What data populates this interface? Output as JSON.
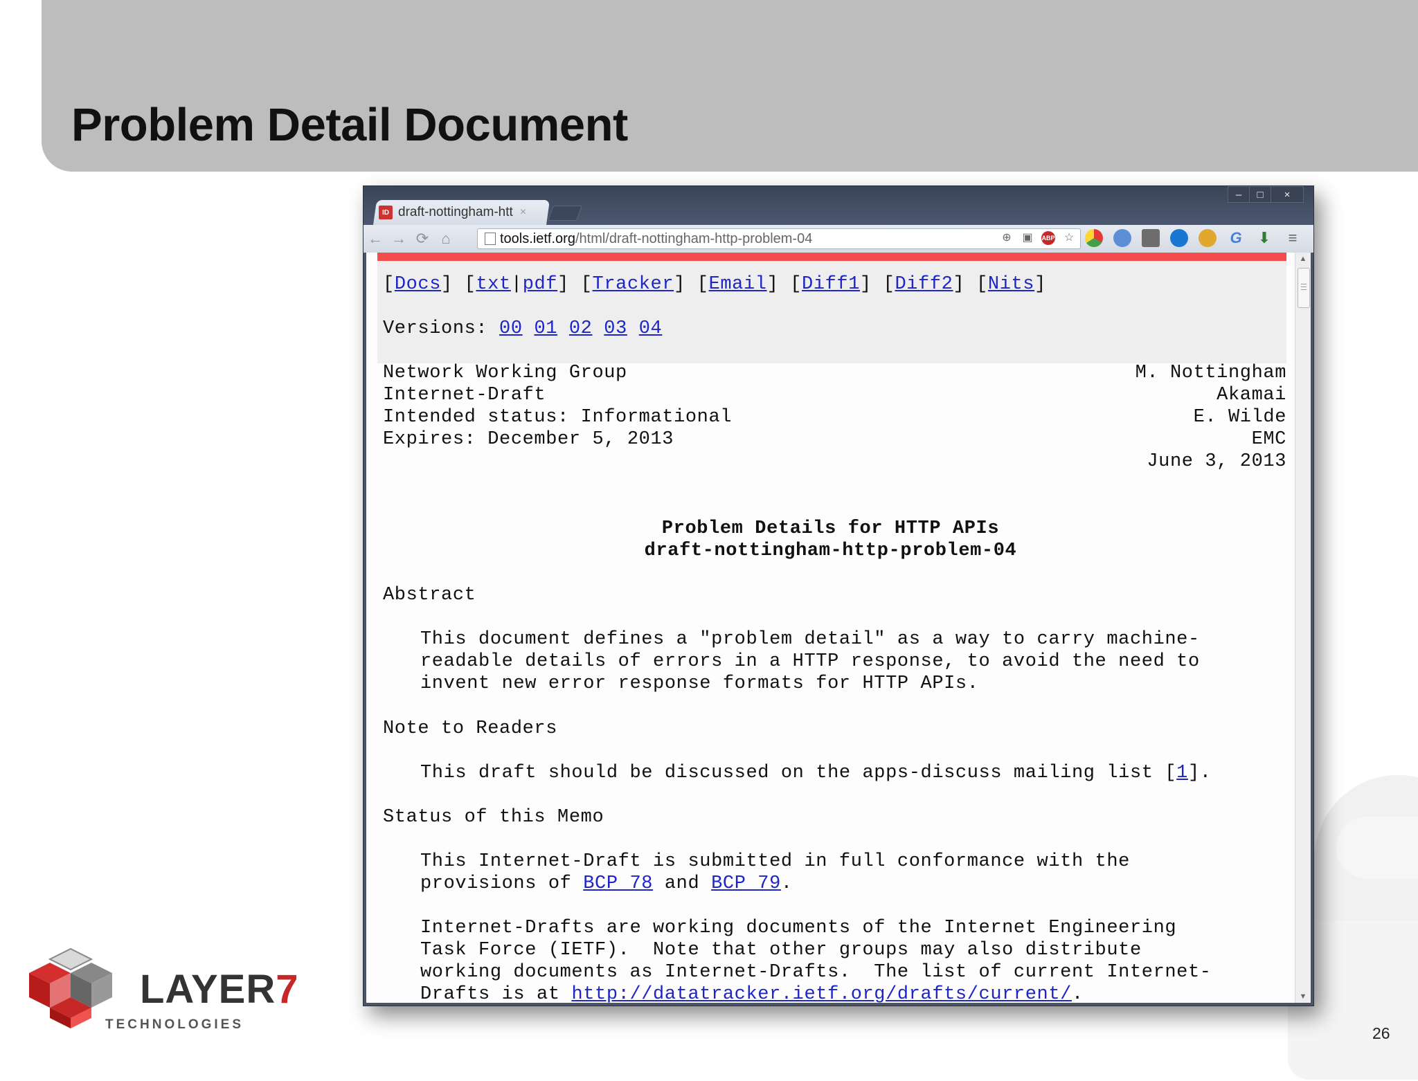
{
  "slide": {
    "title": "Problem Detail Document",
    "page_number": "26"
  },
  "logo": {
    "word": "LAYER",
    "seven": "7",
    "sub": "TECHNOLOGIES"
  },
  "browser": {
    "tab_title": "draft-nottingham-htt",
    "tab_close": "×",
    "favicon_text": "ID",
    "window_controls": {
      "minimize": "–",
      "maximize": "□",
      "close": "×"
    },
    "nav": {
      "back": "←",
      "forward": "→",
      "reload": "⟳",
      "home": "⌂"
    },
    "url_host": "tools.ietf.org",
    "url_path": "/html/draft-nottingham-http-problem-04",
    "omni_icons": {
      "zoom": "⊕",
      "page_action": "▣",
      "adblock": "ABP",
      "star": "☆"
    },
    "menu_icon": "≡"
  },
  "doc": {
    "links_line": {
      "docs": "Docs",
      "txt": "txt",
      "pdf": "pdf",
      "tracker": "Tracker",
      "email": "Email",
      "diff1": "Diff1",
      "diff2": "Diff2",
      "nits": "Nits"
    },
    "versions_label": "Versions: ",
    "versions": [
      "00",
      "01",
      "02",
      "03",
      "04"
    ],
    "header_left": [
      "Network Working Group",
      "Internet-Draft",
      "Intended status: Informational",
      "Expires: December 5, 2013"
    ],
    "header_right": [
      "M. Nottingham",
      "Akamai",
      "E. Wilde",
      "EMC",
      "June 3, 2013"
    ],
    "title_line1": "Problem Details for HTTP APIs",
    "title_line2": "draft-nottingham-http-problem-04",
    "abstract_heading": "Abstract",
    "abstract_lines": [
      "This document defines a \"problem detail\" as a way to carry machine-",
      "readable details of errors in a HTTP response, to avoid the need to",
      "invent new error response formats for HTTP APIs."
    ],
    "note_heading": "Note to Readers",
    "note_text": "This draft should be discussed on the apps-discuss mailing list [",
    "note_ref": "1",
    "note_end": "].",
    "status_heading": "Status of this Memo",
    "status_line1": "This Internet-Draft is submitted in full conformance with the",
    "status_line2_a": "provisions of ",
    "bcp78": "BCP 78",
    "status_line2_b": " and ",
    "bcp79": "BCP 79",
    "status_line2_c": ".",
    "para2_lines": [
      "Internet-Drafts are working documents of the Internet Engineering",
      "Task Force (IETF).  Note that other groups may also distribute",
      "working documents as Internet-Drafts.  The list of current Internet-"
    ],
    "para2_last_a": "Drafts is at ",
    "para2_link": "http://datatracker.ietf.org/drafts/current/",
    "para2_last_b": "."
  }
}
